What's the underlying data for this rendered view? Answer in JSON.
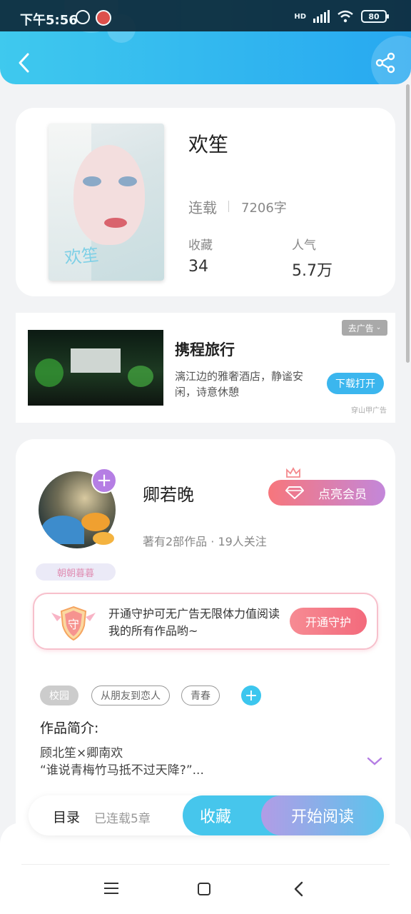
{
  "status_bar": {
    "time": "下午5:56",
    "network": "HD",
    "battery": "80"
  },
  "book": {
    "title": "欢笙",
    "cover_title": "欢笙",
    "status": "连载",
    "word_count": "7206字",
    "stats": [
      {
        "label": "收藏",
        "value": "34"
      },
      {
        "label": "人气",
        "value": "5.7万"
      }
    ]
  },
  "ad": {
    "close_label": "去广告",
    "title": "携程旅行",
    "description": "漓江边的雅奢酒店，静谧安闲，诗意休憩",
    "button": "下载打开",
    "source": "穿山甲广告"
  },
  "author": {
    "name": "卿若晚",
    "badge": "朝朝暮暮",
    "meta": "著有2部作品 · 19人关注",
    "vip_button": "点亮会员",
    "guard_icon_text": "守",
    "guard_text": "开通守护可无广告无限体力值阅读我的所有作品哟~",
    "guard_button": "开通守护"
  },
  "tags": [
    "校园",
    "从朋友到恋人",
    "青春"
  ],
  "intro": {
    "label": "作品简介:",
    "line1": "顾北笙×卿南欢",
    "line2": "“谁说青梅竹马抵不过天降?”..."
  },
  "action_bar": {
    "toc_label": "目录",
    "chapter_count": "已连载5章",
    "collect_button": "收藏",
    "read_button": "开始阅读"
  },
  "colors": {
    "accent": "#3bb6ee",
    "vip": "#f7767c",
    "purple": "#b57ee4"
  }
}
